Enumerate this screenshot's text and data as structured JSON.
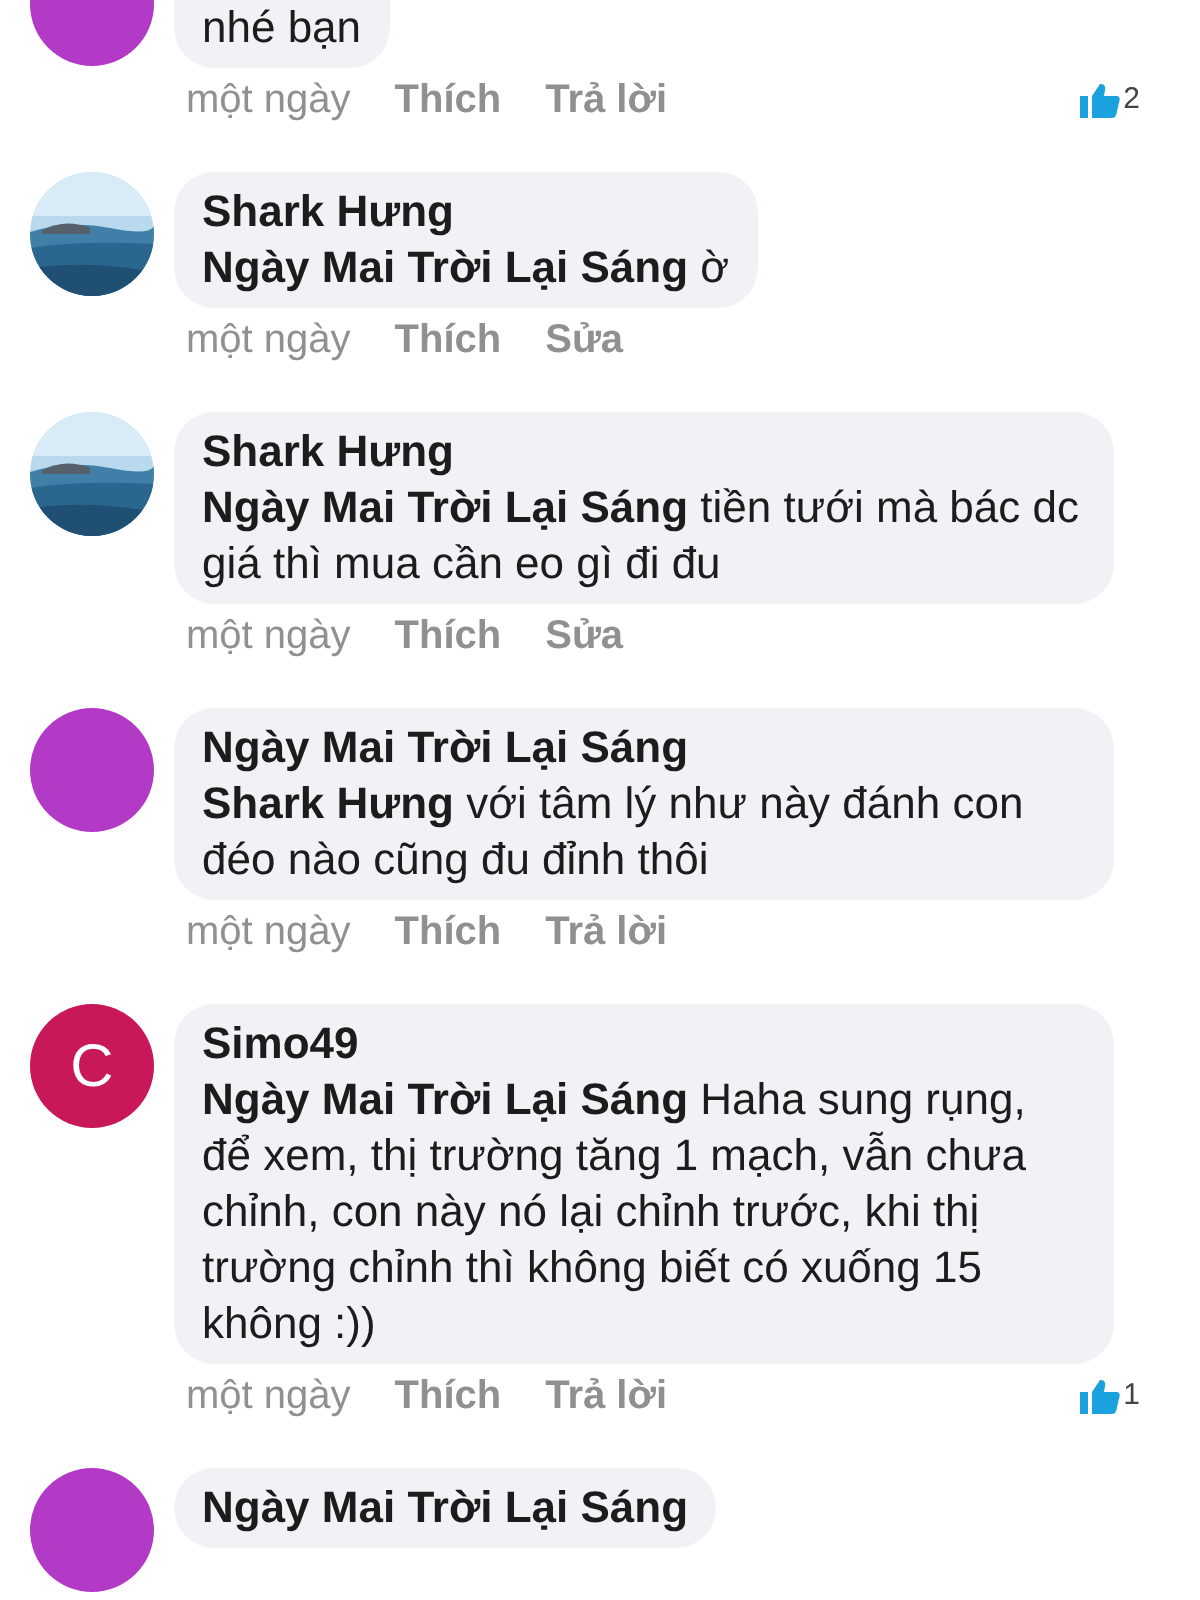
{
  "comments": [
    {
      "avatar": {
        "kind": "color",
        "color": "#b23ac7"
      },
      "text": "nhé bạn",
      "time": "một ngày",
      "like": "Thích",
      "action": "Trả lời",
      "likes": "2"
    },
    {
      "author": "Shark Hưng",
      "text": "**Ngày Mai Trời Lại Sáng**  ờ",
      "time": "một ngày",
      "like": "Thích",
      "action": "Sửa"
    },
    {
      "author": "Shark Hưng",
      "text": "**Ngày Mai Trời Lại Sáng**  tiền tưới mà bác dc giá thì mua cần eo gì đi đu",
      "time": "một ngày",
      "like": "Thích",
      "action": "Sửa"
    },
    {
      "avatar": {
        "kind": "color",
        "color": "#b23ac7"
      },
      "author": "Ngày Mai Trời Lại Sáng",
      "text": "**Shark Hưng**  với tâm lý như này đánh con đéo nào cũng đu đỉnh thôi",
      "time": "một ngày",
      "like": "Thích",
      "action": "Trả lời"
    },
    {
      "avatar": {
        "kind": "letter",
        "color": "#c8185a",
        "letter": "C"
      },
      "author": "Simo49",
      "text": "**Ngày Mai Trời Lại Sáng**  Haha sung rụng, để xem, thị trường tăng 1 mạch, vẫn chưa chỉnh, con này nó lại chỉnh trước, khi thị trường chỉnh thì không biết có xuống 15 không :))",
      "time": "một ngày",
      "like": "Thích",
      "action": "Trả lời",
      "likes": "1"
    },
    {
      "avatar": {
        "kind": "color",
        "color": "#b23ac7"
      },
      "author": "Ngày Mai Trời Lại Sáng"
    }
  ]
}
